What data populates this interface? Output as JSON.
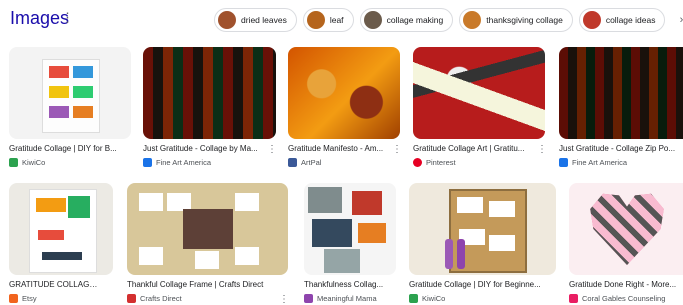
{
  "header": {
    "title": "Images",
    "info_icon": "more-vert-icon"
  },
  "chips": [
    {
      "label": "dried leaves",
      "color": "#a0522d"
    },
    {
      "label": "leaf",
      "color": "#b5651d"
    },
    {
      "label": "collage making",
      "color": "#6b5b4b"
    },
    {
      "label": "thanksgiving collage",
      "color": "#c97a2a"
    },
    {
      "label": "collage ideas",
      "color": "#c0392b"
    }
  ],
  "results": [
    {
      "caption": "Gratitude Collage | DIY for B...",
      "source": "KiwiCo",
      "fav_color": "#2ca24f"
    },
    {
      "caption": "Just Gratitude - Collage by Ma...",
      "source": "Fine Art America",
      "fav_color": "#1a73e8"
    },
    {
      "caption": "Gratitude Manifesto - Am...",
      "source": "ArtPal",
      "fav_color": "#3b5998"
    },
    {
      "caption": "Gratitude Collage Art | Gratitu...",
      "source": "Pinterest",
      "fav_color": "#e60023"
    },
    {
      "caption": "Just Gratitude - Collage Zip Po...",
      "source": "Fine Art America",
      "fav_color": "#1a73e8"
    },
    {
      "caption": "GRATITUDE COLLAGE ...",
      "source": "Etsy",
      "fav_color": "#f1641e"
    },
    {
      "caption": "Thankful Collage Frame | Crafts Direct",
      "source": "Crafts Direct",
      "fav_color": "#d32f2f"
    },
    {
      "caption": "Thankfulness Collag...",
      "source": "Meaningful Mama",
      "fav_color": "#8e44ad"
    },
    {
      "caption": "Gratitude Collage | DIY for Beginne...",
      "source": "KiwiCo",
      "fav_color": "#2ca24f"
    },
    {
      "caption": "Gratitude Done Right - More...",
      "source": "Coral Gables Counseling",
      "fav_color": "#e91e63"
    }
  ]
}
